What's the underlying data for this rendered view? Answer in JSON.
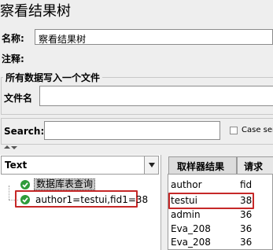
{
  "window": {
    "title": "察看结果树"
  },
  "form": {
    "name_label": "名称:",
    "name_value": "察看结果树",
    "comment_label": "注释:",
    "comment_value": ""
  },
  "file_group": {
    "title": "所有数据写入一个文件",
    "filename_label": "文件名",
    "filename_value": ""
  },
  "search": {
    "label": "Search:",
    "value": "",
    "case_sensitive_label": "Case sen"
  },
  "tree": {
    "renderer_selected": "Text",
    "items": [
      {
        "label": "数据库表查询",
        "status": "success"
      },
      {
        "label": "author1=testui,fid1=38",
        "status": "success"
      }
    ]
  },
  "tabs": [
    {
      "label": "取样器结果"
    },
    {
      "label": "请求"
    }
  ],
  "result_table": {
    "rows": [
      {
        "c1": "author",
        "c2": "fid"
      },
      {
        "c1": "testui",
        "c2": "38"
      },
      {
        "c1": "admin",
        "c2": "36"
      },
      {
        "c1": "Eva_208",
        "c2": "36"
      },
      {
        "c1": "Eva_208",
        "c2": "36"
      }
    ]
  },
  "colors": {
    "highlight": "#c62828",
    "success": "#2e9b3a"
  },
  "icons": {
    "tree_status": "success-check-icon",
    "combo": "chevron-down-icon"
  }
}
